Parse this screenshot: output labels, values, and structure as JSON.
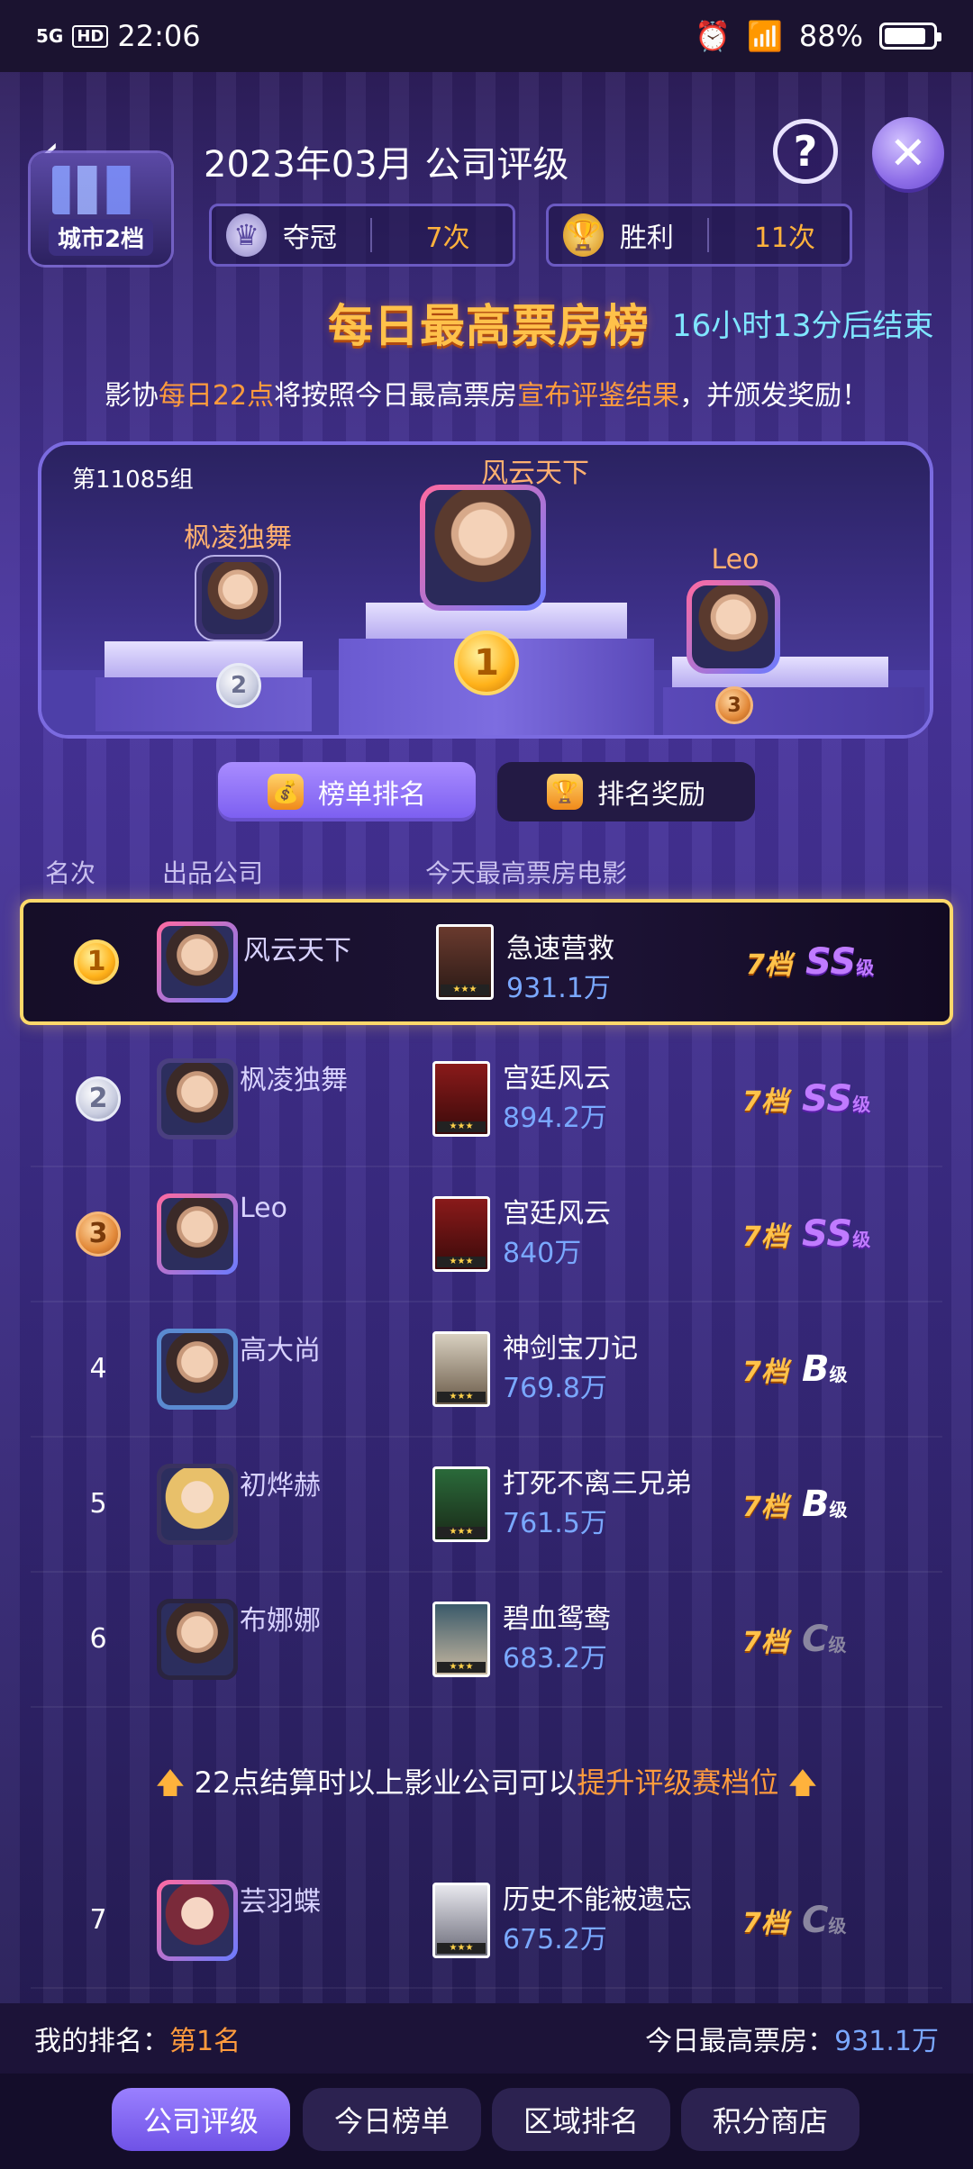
{
  "status_bar": {
    "network": "5G",
    "hd": "HD",
    "time": "22:06",
    "battery": "88%",
    "battery_level": 0.88
  },
  "header": {
    "back_icon": "chevron-left-icon",
    "city_badge": "城市2档",
    "title": "2023年03月 公司评级",
    "help_icon": "question-icon",
    "close_icon": "close-icon",
    "stats": [
      {
        "label": "夺冠",
        "value": "7次",
        "icon": "crown-icon"
      },
      {
        "label": "胜利",
        "value": "11次",
        "icon": "trophy-icon"
      }
    ]
  },
  "board": {
    "title": "每日最高票房榜",
    "countdown": "16小时13分后结束",
    "notice_parts": [
      "影协",
      "每日22点",
      "将按照今日最高票房",
      "宣布评鉴结果",
      "，并颁发奖励！"
    ]
  },
  "podium": {
    "group": "第11085组",
    "first": {
      "name": "风云天下",
      "medal": "1"
    },
    "second": {
      "name": "枫凌独舞",
      "medal": "2"
    },
    "third": {
      "name": "Leo",
      "medal": "3"
    }
  },
  "tabs": [
    {
      "label": "榜单排名",
      "icon": "money-bag-icon",
      "active": true
    },
    {
      "label": "排名奖励",
      "icon": "trophy-icon",
      "active": false
    }
  ],
  "columns": {
    "rank": "名次",
    "company": "出品公司",
    "movie": "今天最高票房电影"
  },
  "rows": [
    {
      "rank": "1",
      "company": "风云天下",
      "movie": "急速营救",
      "box": "931.1万",
      "tier": "7档",
      "grade": "SS",
      "grade_suffix": "级"
    },
    {
      "rank": "2",
      "company": "枫凌独舞",
      "movie": "宫廷风云",
      "box": "894.2万",
      "tier": "7档",
      "grade": "SS",
      "grade_suffix": "级"
    },
    {
      "rank": "3",
      "company": "Leo",
      "movie": "宫廷风云",
      "box": "840万",
      "tier": "7档",
      "grade": "SS",
      "grade_suffix": "级"
    },
    {
      "rank": "4",
      "company": "高大尚",
      "movie": "神剑宝刀记",
      "box": "769.8万",
      "tier": "7档",
      "grade": "B",
      "grade_suffix": "级"
    },
    {
      "rank": "5",
      "company": "初烨赫",
      "movie": "打死不离三兄弟",
      "box": "761.5万",
      "tier": "7档",
      "grade": "B",
      "grade_suffix": "级"
    },
    {
      "rank": "6",
      "company": "布娜娜",
      "movie": "碧血鸳鸯",
      "box": "683.2万",
      "tier": "7档",
      "grade": "C",
      "grade_suffix": "级"
    },
    {
      "rank": "7",
      "company": "芸羽蝶",
      "movie": "历史不能被遗忘",
      "box": "675.2万",
      "tier": "7档",
      "grade": "C",
      "grade_suffix": "级"
    }
  ],
  "promo": {
    "text": "22点结算时以上影业公司可以",
    "highlight": "提升评级赛档位"
  },
  "footer": {
    "my_rank_label": "我的排名：",
    "my_rank": "第1名",
    "today_label": "今日最高票房：",
    "today_value": "931.1万"
  },
  "bottom_nav": [
    "公司评级",
    "今日榜单",
    "区域排名",
    "积分商店"
  ],
  "poster_stars": "★★★",
  "colors": {
    "accent_orange": "#ff9b3d",
    "box_blue": "#7aa8ff",
    "gold_border": "#ffd86a",
    "ss_purple": "#c07bff"
  }
}
